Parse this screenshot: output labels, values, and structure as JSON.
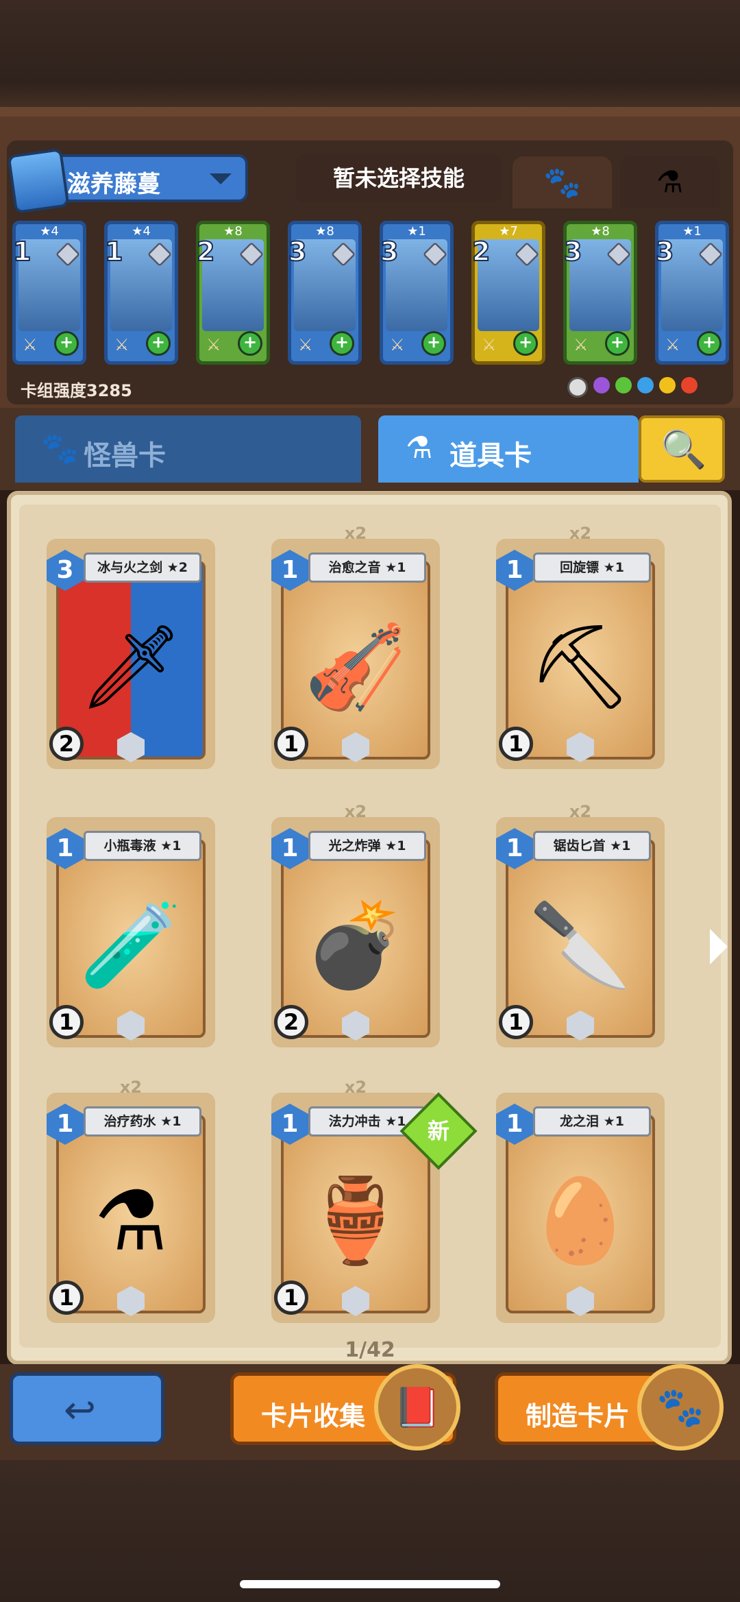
{
  "deck": {
    "name": "滋养藤蔓",
    "skill": "暂未选择技能",
    "strength_label": "卡组强度3285"
  },
  "monster_cards": [
    {
      "stars": "★4",
      "cost": "1",
      "color": "blue"
    },
    {
      "stars": "★4",
      "cost": "1",
      "color": "blue"
    },
    {
      "stars": "★8",
      "cost": "2",
      "color": "green"
    },
    {
      "stars": "★8",
      "cost": "3",
      "color": "blue"
    },
    {
      "stars": "★1",
      "cost": "3",
      "color": "blue"
    },
    {
      "stars": "★7",
      "cost": "2",
      "color": "yellow"
    },
    {
      "stars": "★8",
      "cost": "3",
      "color": "green"
    },
    {
      "stars": "★1",
      "cost": "3",
      "color": "blue"
    }
  ],
  "tabs": {
    "monster": "怪兽卡",
    "item": "道具卡"
  },
  "item_cards": [
    {
      "name": "冰与火之剑 ★2",
      "cost": "3",
      "dup": "",
      "lvl": "2",
      "icon": "🗡"
    },
    {
      "name": "治愈之音 ★1",
      "cost": "1",
      "dup": "x2",
      "lvl": "1",
      "icon": "🎻"
    },
    {
      "name": "回旋镖 ★1",
      "cost": "1",
      "dup": "x2",
      "lvl": "1",
      "icon": "⛏"
    },
    {
      "name": "小瓶毒液 ★1",
      "cost": "1",
      "dup": "",
      "lvl": "1",
      "icon": "🧪"
    },
    {
      "name": "光之炸弹 ★1",
      "cost": "1",
      "dup": "x2",
      "lvl": "2",
      "icon": "💣"
    },
    {
      "name": "锯齿匕首 ★1",
      "cost": "1",
      "dup": "x2",
      "lvl": "1",
      "icon": "🔪"
    },
    {
      "name": "治疗药水 ★1",
      "cost": "1",
      "dup": "x2",
      "lvl": "1",
      "icon": "⚗"
    },
    {
      "name": "法力冲击 ★1",
      "cost": "1",
      "dup": "x2",
      "lvl": "1",
      "icon": "🏺"
    },
    {
      "name": "龙之泪 ★1",
      "cost": "1",
      "dup": "",
      "lvl": "",
      "icon": "🥚"
    }
  ],
  "new_badge": "新",
  "page_indicator": "1/42",
  "buttons": {
    "collect": "卡片收集",
    "craft": "制造卡片"
  },
  "colors": {
    "accent_blue": "#4c9be8",
    "orange": "#f28a22",
    "gold": "#f4c630"
  }
}
